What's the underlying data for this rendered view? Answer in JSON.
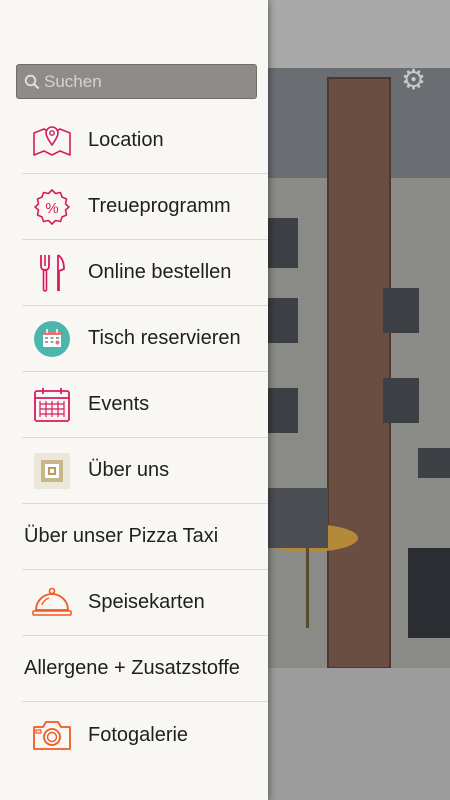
{
  "search": {
    "placeholder": "Suchen",
    "value": ""
  },
  "menu": [
    {
      "label": "Location",
      "icon": "map-location-icon"
    },
    {
      "label": "Treueprogramm",
      "icon": "percent-badge-icon"
    },
    {
      "label": "Online bestellen",
      "icon": "fork-knife-icon"
    },
    {
      "label": "Tisch reservieren",
      "icon": "calendar-circle-icon"
    },
    {
      "label": "Events",
      "icon": "calendar-grid-icon"
    },
    {
      "label": "Über uns",
      "icon": "info-logo-icon"
    },
    {
      "label": "Über unser Pizza Taxi",
      "icon": ""
    },
    {
      "label": "Speisekarten",
      "icon": "cloche-icon"
    },
    {
      "label": "Allergene + Zusatzstoffe",
      "icon": ""
    },
    {
      "label": "Fotogalerie",
      "icon": "camera-icon"
    }
  ],
  "colors": {
    "accent": "#d81b60",
    "orange": "#f05a22",
    "drawer_bg": "#f8f7f3",
    "search_bg": "#8e8c88"
  }
}
